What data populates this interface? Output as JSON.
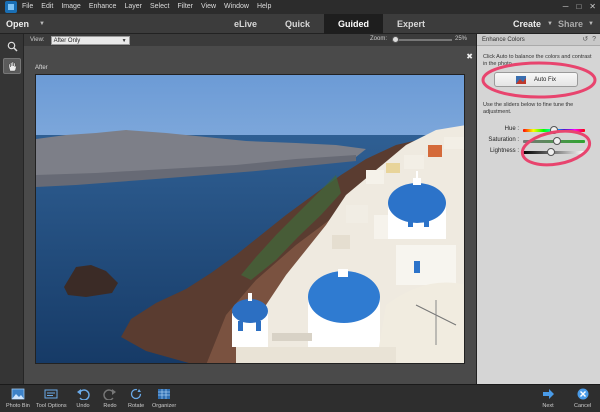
{
  "menu": {
    "items": [
      "File",
      "Edit",
      "Image",
      "Enhance",
      "Layer",
      "Select",
      "Filter",
      "View",
      "Window",
      "Help"
    ]
  },
  "modebar": {
    "open_label": "Open",
    "tabs": [
      {
        "label": "eLive",
        "active": false
      },
      {
        "label": "Quick",
        "active": false
      },
      {
        "label": "Guided",
        "active": true
      },
      {
        "label": "Expert",
        "active": false
      }
    ],
    "create_label": "Create",
    "share_label": "Share"
  },
  "options": {
    "view_label": "View:",
    "view_value": "After Only",
    "zoom_label": "Zoom:",
    "zoom_value": "25%",
    "zoom_fraction": 0.05
  },
  "canvas": {
    "after_label": "After",
    "close_glyph": "✖"
  },
  "panel": {
    "title": "Enhance Colors",
    "instruction_1": "Click Auto to balance the colors and contrast in the photo.",
    "auto_fix_label": "Auto Fix",
    "instruction_2": "Use the sliders below to fine tune the adjustment.",
    "sliders": [
      {
        "label": "Hue :",
        "value": 0.5
      },
      {
        "label": "Saturation :",
        "value": 0.55
      },
      {
        "label": "Lightness :",
        "value": 0.45
      }
    ]
  },
  "bottom": {
    "photo_bin": "Photo Bin",
    "tool_options": "Tool Options",
    "undo": "Undo",
    "redo": "Redo",
    "rotate": "Rotate",
    "organizer": "Organizer",
    "next": "Next",
    "cancel": "Cancel"
  },
  "colors": {
    "annotation": "#e8446e",
    "hue_gradient": "linear-gradient(to right, #f00, #ff0, #0f0, #0ff, #00f, #f0f, #f00)",
    "saturation_gradient": "linear-gradient(to right, #777, #2fa52f)",
    "lightness_gradient": "linear-gradient(to right, #000, #777, #fff)"
  }
}
